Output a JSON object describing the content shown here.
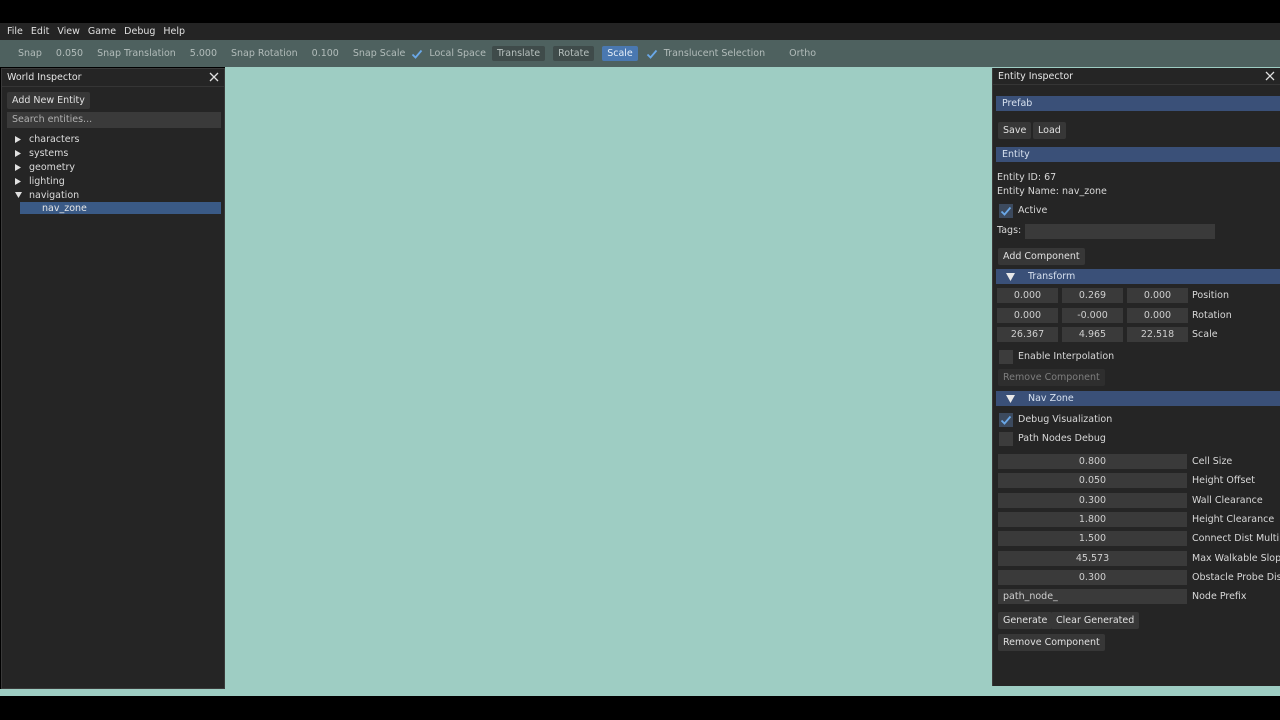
{
  "menu": [
    "File",
    "Edit",
    "View",
    "Game",
    "Debug",
    "Help"
  ],
  "toolbar": {
    "snap": "Snap",
    "snap_value": "0.050",
    "snap_translation": "Snap Translation",
    "snap_translation_value": "5.000",
    "snap_rotation": "Snap Rotation",
    "snap_rotation_value": "0.100",
    "snap_scale": "Snap Scale",
    "local_space": "Local Space",
    "translate": "Translate",
    "rotate": "Rotate",
    "scale": "Scale",
    "translucent_selection": "Translucent Selection",
    "ortho": "Ortho"
  },
  "world": {
    "title": "World Inspector",
    "add_entity": "Add New Entity",
    "search_placeholder": "Search entities...",
    "tree": [
      "characters",
      "systems",
      "geometry",
      "lighting",
      "navigation"
    ],
    "selected_child": "nav_zone"
  },
  "entity": {
    "title": "Entity Inspector",
    "prefab_header": "Prefab",
    "save": "Save",
    "load": "Load",
    "entity_header": "Entity",
    "entity_id": "Entity ID: 67",
    "entity_name": "Entity Name: nav_zone",
    "active": "Active",
    "tags": "Tags:",
    "add_component": "Add Component",
    "transform": {
      "header": "Transform",
      "position": [
        "0.000",
        "0.269",
        "0.000"
      ],
      "rotation": [
        "0.000",
        "-0.000",
        "0.000"
      ],
      "scale": [
        "26.367",
        "4.965",
        "22.518"
      ],
      "position_label": "Position",
      "rotation_label": "Rotation",
      "scale_label": "Scale",
      "enable_interpolation": "Enable Interpolation",
      "remove_component": "Remove Component"
    },
    "navzone": {
      "header": "Nav Zone",
      "debug_visualization": "Debug Visualization",
      "path_nodes_debug": "Path Nodes Debug",
      "fields": [
        {
          "value": "0.800",
          "label": "Cell Size"
        },
        {
          "value": "0.050",
          "label": "Height Offset"
        },
        {
          "value": "0.300",
          "label": "Wall Clearance"
        },
        {
          "value": "1.800",
          "label": "Height Clearance"
        },
        {
          "value": "1.500",
          "label": "Connect Dist Multiplier"
        },
        {
          "value": "45.573",
          "label": "Max Walkable Slope (deg)"
        },
        {
          "value": "0.300",
          "label": "Obstacle Probe Dist"
        }
      ],
      "node_prefix_value": "path_node_",
      "node_prefix_label": "Node Prefix",
      "generate": "Generate",
      "clear_generated": "Clear Generated",
      "remove_component": "Remove Component"
    }
  },
  "colors": {
    "viewport": "#9ecdc3",
    "toolbar": "#4e615f",
    "panel": "#252525",
    "section": "#3a5078",
    "accent": "#4a78b0"
  }
}
